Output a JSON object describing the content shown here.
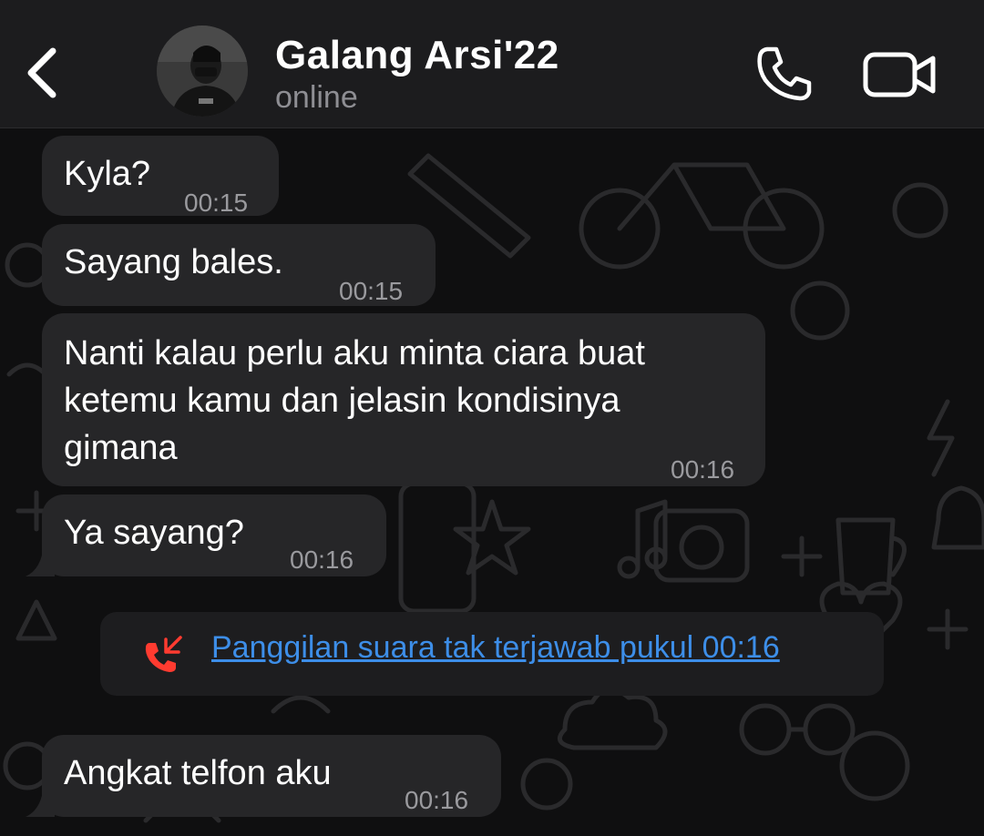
{
  "header": {
    "contact_name": "Galang Arsi'22",
    "status": "online",
    "icons": {
      "back": "chevron-left-icon",
      "call": "phone-icon",
      "video": "video-camera-icon"
    }
  },
  "messages": [
    {
      "text": "Kyla?",
      "time": "00:15"
    },
    {
      "text": "Sayang bales.",
      "time": "00:15"
    },
    {
      "text": "Nanti kalau perlu aku minta ciara buat\nketemu kamu dan jelasin kondisinya\ngimana",
      "time": "00:16"
    },
    {
      "text": "Ya sayang?",
      "time": "00:16"
    },
    {
      "text": "Angkat telfon aku",
      "time": "00:16"
    }
  ],
  "call_notice": {
    "text": "Panggilan suara tak terjawab pukul 00:16",
    "icon": "missed-call-icon"
  },
  "colors": {
    "header_bg": "#1c1c1e",
    "bubble_bg": "#262628",
    "link_blue": "#3d8ee8",
    "missed_red": "#ff3b30"
  }
}
